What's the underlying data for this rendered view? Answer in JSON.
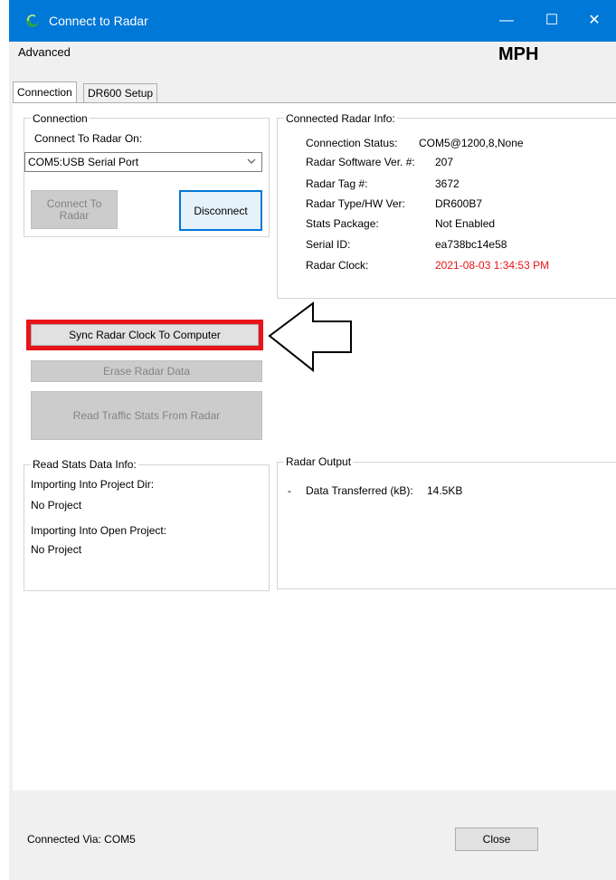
{
  "window": {
    "title": "Connect to Radar"
  },
  "titlebar_buttons": {
    "minimize": "—",
    "maximize": "☐",
    "close": "✕"
  },
  "menu": {
    "advanced": "Advanced",
    "units": "MPH"
  },
  "tabs": [
    {
      "label": "Connection"
    },
    {
      "label": "DR600 Setup"
    }
  ],
  "connection": {
    "group_title": "Connection",
    "connect_on_label": "Connect To Radar On:",
    "port_value": "COM5:USB Serial Port",
    "connect_button": "Connect To Radar",
    "disconnect_button": "Disconnect"
  },
  "radar_info": {
    "group_title": "Connected Radar Info:",
    "rows": [
      {
        "label": "Connection Status:",
        "value": "COM5@1200,8,None"
      },
      {
        "label": "Radar Software Ver. #:",
        "value": "207"
      },
      {
        "label": "Radar Tag #:",
        "value": "3672"
      },
      {
        "label": "Radar Type/HW Ver:",
        "value": "DR600B7"
      },
      {
        "label": "Stats Package:",
        "value": "Not Enabled"
      },
      {
        "label": "Serial ID:",
        "value": "ea738bc14e58"
      },
      {
        "label": "Radar Clock:",
        "value": "2021-08-03 1:34:53 PM"
      }
    ],
    "clock_color": "#e8141a"
  },
  "actions": {
    "sync_clock": "Sync Radar Clock To Computer",
    "erase_data": "Erase Radar Data",
    "read_stats": "Read Traffic Stats From Radar"
  },
  "stats_info": {
    "group_title": "Read Stats Data Info:",
    "project_dir_label": "Importing Into Project Dir:",
    "project_dir_value": "No Project",
    "open_project_label": "Importing Into Open Project:",
    "open_project_value": "No Project"
  },
  "radar_output": {
    "group_title": "Radar Output",
    "bullet": "-",
    "transferred_label": "Data Transferred (kB):",
    "transferred_value": "14.5KB"
  },
  "footer": {
    "connected_via": "Connected Via:  COM5",
    "close_button": "Close"
  },
  "colors": {
    "accent": "#0078d7",
    "highlight": "#e8141a"
  }
}
